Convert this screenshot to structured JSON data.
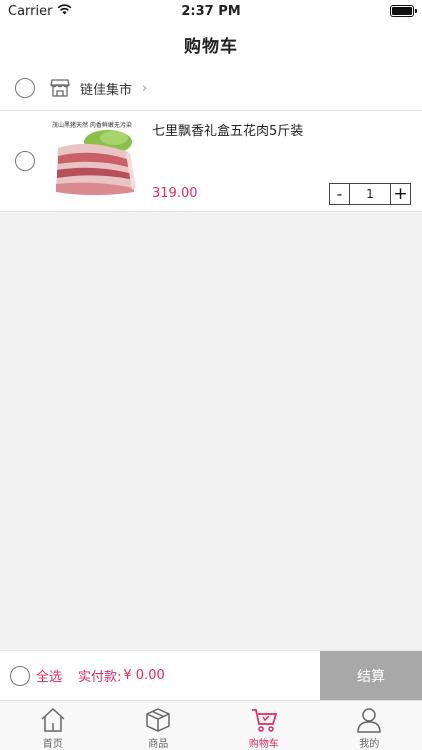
{
  "status_bar": {
    "carrier": "Carrier",
    "time": "2:37 PM"
  },
  "nav": {
    "title": "购物车"
  },
  "store": {
    "name": "链佳集市",
    "chevron": "›",
    "icon": "store-icon"
  },
  "cart_items": [
    {
      "title": "七里飘香礼盒五花肉5斤装",
      "price": "319.00",
      "quantity": "1",
      "minus_label": "-",
      "plus_label": "+",
      "image_caption": "茂山黑猪天然  肉香鲜嫩无污染"
    }
  ],
  "bottom_bar": {
    "select_all_label": "全选",
    "total_label": "实付款:",
    "total_value": "¥ 0.00",
    "checkout_label": "结算"
  },
  "tabs": [
    {
      "label": "首页",
      "icon": "home-icon",
      "active": false
    },
    {
      "label": "商品",
      "icon": "box-icon",
      "active": false
    },
    {
      "label": "购物车",
      "icon": "cart-icon",
      "active": true
    },
    {
      "label": "我的",
      "icon": "user-icon",
      "active": false
    }
  ],
  "colors": {
    "accent": "#e0295a",
    "checkout_bg": "#a8a8a8",
    "page_bg": "#f2f2f2"
  }
}
